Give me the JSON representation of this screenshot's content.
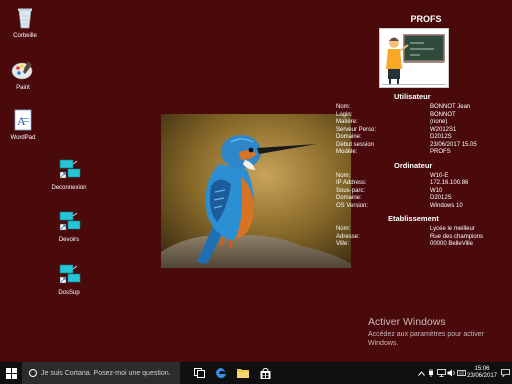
{
  "desktop_icons": [
    {
      "label": "Corbeille"
    },
    {
      "label": "Paint"
    },
    {
      "label": "WordPad"
    },
    {
      "label": "Deconnexion"
    },
    {
      "label": "Devoirs"
    },
    {
      "label": "DosSup"
    }
  ],
  "info_panel": {
    "title": "PROFS",
    "user_section": {
      "title": "Utilisateur",
      "rows": [
        {
          "key": "Nom:",
          "value": "BONNOT Jean"
        },
        {
          "key": "Login:",
          "value": "BONNOT"
        },
        {
          "key": "Matière:",
          "value": "(none)"
        },
        {
          "key": "Serveur Perso:",
          "value": "W2012S1"
        },
        {
          "key": "Domaine:",
          "value": "D2012S"
        },
        {
          "key": "Début session",
          "value": "23/06/2017 15.05"
        },
        {
          "key": "Modèle:",
          "value": "PROFS"
        }
      ]
    },
    "computer_section": {
      "title": "Ordinateur",
      "rows": [
        {
          "key": "Nom:",
          "value": "W10-E"
        },
        {
          "key": "IP Address:",
          "value": "172.16.100.86"
        },
        {
          "key": "Sous-parc:",
          "value": "W10"
        },
        {
          "key": "Domaine:",
          "value": "D2012S"
        },
        {
          "key": "OS Version:",
          "value": "Windows 10"
        }
      ]
    },
    "school_section": {
      "title": "Etablissement",
      "rows": [
        {
          "key": "Nom:",
          "value": "Lycée le meilleur"
        },
        {
          "key": "Adresse:",
          "value": "Rue des champions"
        },
        {
          "key": "Ville:",
          "value": "00000 BelleVille"
        }
      ]
    }
  },
  "activation": {
    "title": "Activer Windows",
    "subtitle": "Accédez aux paramètres pour activer Windows."
  },
  "taskbar": {
    "search_placeholder": "Je suis Cortana. Posez-moi une question.",
    "time": "15:06",
    "date": "23/06/2017"
  },
  "colors": {
    "desktop_bg": "#4a0a0c",
    "taskbar_bg": "#101010",
    "edge_blue": "#3b8ee6"
  }
}
